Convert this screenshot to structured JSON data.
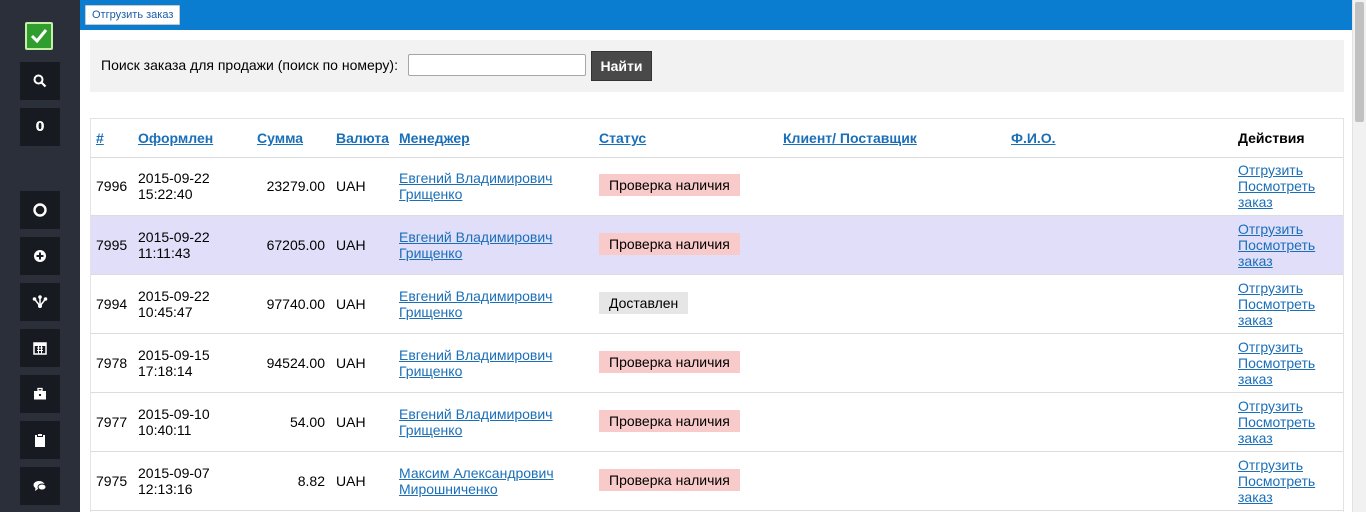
{
  "topbar": {
    "ship_order_button": "Отгрузить заказ"
  },
  "sidebar": {
    "counter": "0",
    "items": [
      {
        "icon": "search-icon"
      },
      {
        "icon": "counter"
      },
      {
        "icon": "life-ring-icon"
      },
      {
        "icon": "plus-circle-icon"
      },
      {
        "icon": "sitemap-icon"
      },
      {
        "icon": "calendar-icon"
      },
      {
        "icon": "briefcase-icon"
      },
      {
        "icon": "clipboard-icon"
      },
      {
        "icon": "comments-icon"
      }
    ]
  },
  "search": {
    "label": "Поиск заказа для продажи (поиск по номеру):",
    "value": "",
    "placeholder": "",
    "button": "Найти"
  },
  "table": {
    "headers": {
      "id": "#",
      "date": "Оформлен",
      "sum": "Сумма",
      "currency": "Валюта",
      "manager": "Менеджер",
      "status": "Статус",
      "client": "Клиент/ Поставщик",
      "fio": "Ф.И.О.",
      "actions": "Действия"
    },
    "rows": [
      {
        "id": "7996",
        "date1": "2015-09-22",
        "date2": "15:22:40",
        "sum": "23279.00",
        "currency": "UAH",
        "mgr1": "Евгений Владимирович",
        "mgr2": "Грищенко",
        "status": "Проверка наличия",
        "client": "",
        "fio": "",
        "a1": "Отгрузить",
        "a2": "Посмотреть",
        "a3": "заказ"
      },
      {
        "id": "7995",
        "date1": "2015-09-22",
        "date2": "11:11:43",
        "sum": "67205.00",
        "currency": "UAH",
        "mgr1": "Евгений Владимирович",
        "mgr2": "Грищенко",
        "status": "Проверка наличия",
        "client": "",
        "fio": "",
        "a1": "Отгрузить",
        "a2": "Посмотреть",
        "a3": "заказ"
      },
      {
        "id": "7994",
        "date1": "2015-09-22",
        "date2": "10:45:47",
        "sum": "97740.00",
        "currency": "UAH",
        "mgr1": "Евгений Владимирович",
        "mgr2": "Грищенко",
        "status": "Доставлен",
        "client": "",
        "fio": "",
        "a1": "Отгрузить",
        "a2": "Посмотреть",
        "a3": "заказ"
      },
      {
        "id": "7978",
        "date1": "2015-09-15",
        "date2": "17:18:14",
        "sum": "94524.00",
        "currency": "UAH",
        "mgr1": "Евгений Владимирович",
        "mgr2": "Грищенко",
        "status": "Проверка наличия",
        "client": "",
        "fio": "",
        "a1": "Отгрузить",
        "a2": "Посмотреть",
        "a3": "заказ"
      },
      {
        "id": "7977",
        "date1": "2015-09-10",
        "date2": "10:40:11",
        "sum": "54.00",
        "currency": "UAH",
        "mgr1": "Евгений Владимирович",
        "mgr2": "Грищенко",
        "status": "Проверка наличия",
        "client": "",
        "fio": "",
        "a1": "Отгрузить",
        "a2": "Посмотреть",
        "a3": "заказ"
      },
      {
        "id": "7975",
        "date1": "2015-09-07",
        "date2": "12:13:16",
        "sum": "8.82",
        "currency": "UAH",
        "mgr1": "Максим Александрович",
        "mgr2": "Мирошниченко",
        "status": "Проверка наличия",
        "client": "",
        "fio": "",
        "a1": "Отгрузить",
        "a2": "Посмотреть",
        "a3": "заказ"
      }
    ]
  },
  "colors": {
    "topbar": "#0a7dd1",
    "sidebar": "#2b2f3a",
    "status_check": "#f8caca",
    "status_delivered": "#e6e6e6",
    "row_highlight": "#e1defa",
    "link": "#1a6fb8"
  }
}
